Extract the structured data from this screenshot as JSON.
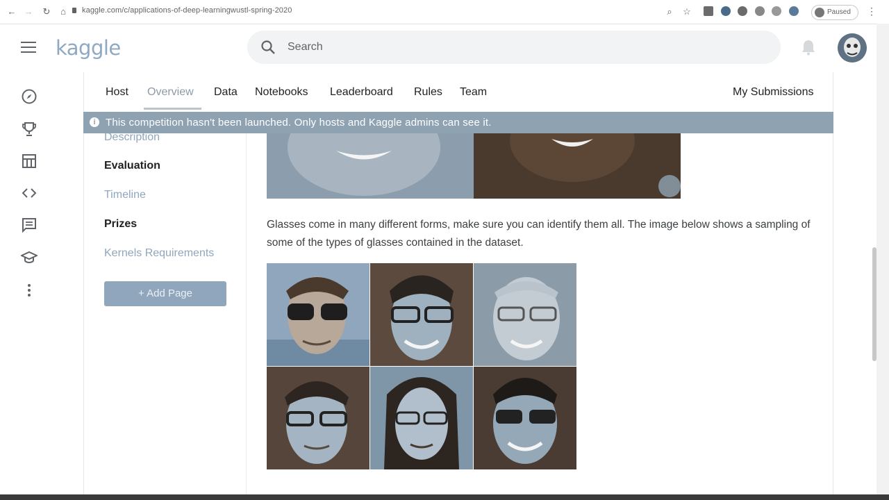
{
  "browser": {
    "url": "kaggle.com/c/applications-of-deep-learningwustl-spring-2020",
    "profile_status": "Paused"
  },
  "header": {
    "logo": "kaggle",
    "search_placeholder": "Search"
  },
  "tabs": [
    {
      "label": "Host"
    },
    {
      "label": "Overview",
      "active": true
    },
    {
      "label": "Data"
    },
    {
      "label": "Notebooks"
    },
    {
      "label": "Leaderboard"
    },
    {
      "label": "Rules"
    },
    {
      "label": "Team"
    }
  ],
  "my_submissions": "My Submissions",
  "banner": {
    "icon": "info-icon",
    "text": "This competition hasn't been launched. Only hosts and Kaggle admins can see it."
  },
  "side_nav": {
    "items": [
      {
        "label": "Description"
      },
      {
        "label": "Evaluation"
      },
      {
        "label": "Timeline"
      },
      {
        "label": "Prizes"
      },
      {
        "label": "Kernels Requirements"
      }
    ],
    "add_page": "+ Add Page"
  },
  "content": {
    "paragraph": "Glasses come in many different forms, make sure you can identify them all. The image below shows a sampling of some of the types of glasses contained in the dataset."
  },
  "rail_icons": [
    "compass-icon",
    "trophy-icon",
    "table-icon",
    "code-icon",
    "comment-icon",
    "school-icon",
    "more-vert-icon"
  ],
  "colors": {
    "banner": "#8ea2b2",
    "active_tab": "#8c9aa8",
    "link": "#8fa6bd"
  }
}
